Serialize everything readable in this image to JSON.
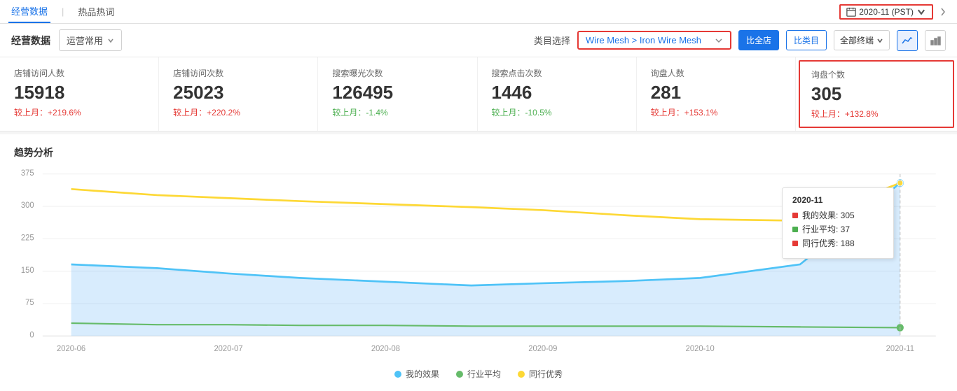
{
  "topnav": {
    "items": [
      "经营数据",
      "热品热词"
    ],
    "active": "经营数据",
    "date_label": "2020-11 (PST)",
    "calendar_icon": "📅"
  },
  "toolbar": {
    "section_title": "经营数据",
    "dropdown_label": "运营常用",
    "category_label": "类目选择",
    "category_value": "Wire Mesh > Iron Wire Mesh",
    "compare_shop": "比全店",
    "compare_category": "比类目",
    "terminal_label": "全部终端",
    "buttons": {
      "line_chart": "~",
      "bar_chart": "≡"
    }
  },
  "metrics": [
    {
      "label": "店铺访问人数",
      "value": "15918",
      "change": "较上月：+219.6%",
      "change_type": "positive",
      "highlighted": false
    },
    {
      "label": "店铺访问次数",
      "value": "25023",
      "change": "较上月：+220.2%",
      "change_type": "positive",
      "highlighted": false
    },
    {
      "label": "搜索曝光次数",
      "value": "126495",
      "change": "较上月：-1.4%",
      "change_type": "negative",
      "highlighted": false
    },
    {
      "label": "搜索点击次数",
      "value": "1446",
      "change": "较上月：-10.5%",
      "change_type": "negative",
      "highlighted": false
    },
    {
      "label": "询盘人数",
      "value": "281",
      "change": "较上月：+153.1%",
      "change_type": "positive",
      "highlighted": false
    },
    {
      "label": "询盘个数",
      "value": "305",
      "change": "较上月：+132.8%",
      "change_type": "positive",
      "highlighted": true
    }
  ],
  "chart": {
    "title": "趋势分析",
    "y_labels": [
      "375",
      "300",
      "225",
      "150",
      "75",
      "0"
    ],
    "x_labels": [
      "2020-06",
      "2020-07",
      "2020-08",
      "2020-09",
      "2020-10",
      "2020-11"
    ],
    "tooltip": {
      "date": "2020-11",
      "rows": [
        {
          "label": "我的效果: 305",
          "color": "#e53935"
        },
        {
          "label": "行业平均: 37",
          "color": "#4caf50"
        },
        {
          "label": "同行优秀: 188",
          "color": "#e53935"
        }
      ]
    },
    "legend": [
      {
        "label": "我的效果",
        "color": "#4fc3f7"
      },
      {
        "label": "行业平均",
        "color": "#66bb6a"
      },
      {
        "label": "同行优秀",
        "color": "#fdd835"
      }
    ]
  }
}
